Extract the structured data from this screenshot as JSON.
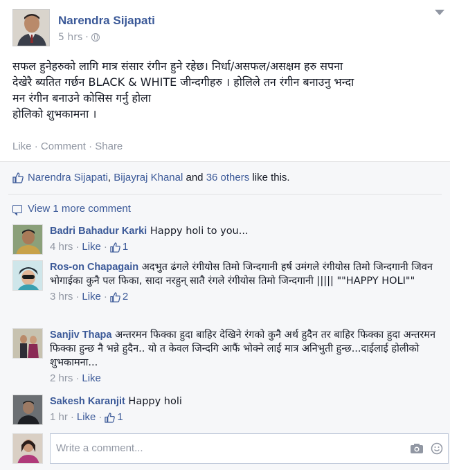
{
  "post": {
    "author": "Narendra Sijapati",
    "timestamp": "5 hrs",
    "separator": "·",
    "text_lines": [
      "सफल हुनेहरुको लागि मात्र संसार रंगीन हुने रहेछ। निर्धा/असफल/असक्षम हरु सपना",
      "देखेरै ब्यतित गर्छन BLACK & WHITE जीन्दगीहरु । होलिले तन रंगीन बनाउनु भन्दा",
      "मन रंगीन बनाउने कोसिस गर्नु होला",
      "होलिको शुभकामना ।"
    ],
    "actions": {
      "like": "Like",
      "comment": "Comment",
      "share": "Share",
      "dot": "·"
    }
  },
  "feedback": {
    "likers": {
      "first": "Narendra Sijapati",
      "comma": ",",
      "second": "Bijayraj Khanal",
      "and": "and",
      "others": "36 others",
      "suffix": "like this."
    },
    "view_more": "View 1 more comment",
    "comments": [
      {
        "name": "Badri Bahadur Karki",
        "text": "Happy holi to you...",
        "time": "4 hrs",
        "like": "Like",
        "likes": "1"
      },
      {
        "name": "Ros-on Chapagain",
        "text": "अदभुत ढंगले रंगीयोस तिमो जिन्दगानी हर्ष उमंगले रंगीयोस तिमो जिन्दगानी जिवन भोगाईका कुनै पल फिका, सादा नरहुन् सातै रंगले रंगीयोस तिमो जिन्दगानी ||||| \"\"HAPPY HOLI\"\"",
        "time": "3 hrs",
        "like": "Like",
        "likes": "2"
      },
      {
        "name": "Sanjiv Thapa",
        "text": "अन्तरमन फिक्का हुदा बाहिर देखिने रंगको कुनै अर्थ हुदैन तर बाहिर फिक्का हुदा अन्तरमन फिक्का हुन्छ नै भन्ने हुदैन.. यो त केवल जिन्दगि आफैं भोक्ने लाई मात्र अनिभुती हुन्छ...दाईलाई होलीको शुभकामना...",
        "time": "2 hrs",
        "like": "Like",
        "likes": ""
      },
      {
        "name": "Sakesh Karanjit",
        "text": "Happy holi",
        "time": "1 hr",
        "like": "Like",
        "likes": "1"
      }
    ],
    "write_placeholder": "Write a comment..."
  },
  "icons": {
    "globe": "globe-icon",
    "thumb": "thumbs-up-icon",
    "bubble": "comment-bubble-icon",
    "camera": "camera-icon",
    "smile": "smile-icon"
  },
  "colors": {
    "link": "#3b5998",
    "muted": "#9197a3",
    "text": "#141823",
    "feedback_bg": "#f6f7f9"
  }
}
